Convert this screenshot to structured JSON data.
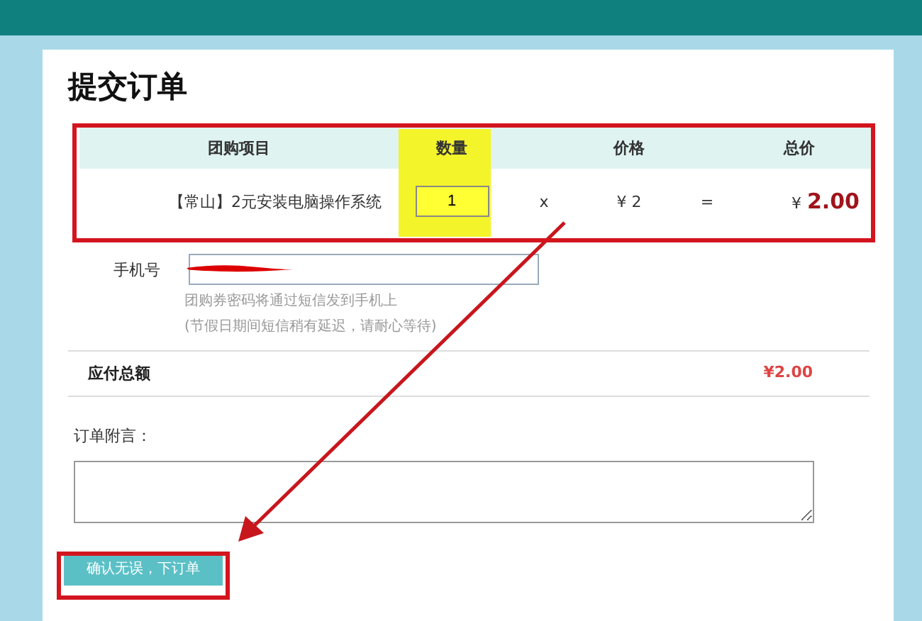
{
  "page": {
    "title": "提交订单"
  },
  "order_table": {
    "columns": [
      "团购项目",
      "数量",
      "",
      "价格",
      "",
      "总价"
    ],
    "row": {
      "item": "【常山】2元安装电脑操作系统",
      "quantity": "1",
      "times": "x",
      "price": "¥ 2",
      "equals": "=",
      "total_currency": "¥",
      "total": "2.00"
    }
  },
  "phone": {
    "label": "手机号",
    "redacted": true,
    "hints": [
      "团购券密码将通过短信发到手机上",
      "(节假日期间短信稍有延迟，请耐心等待)"
    ]
  },
  "summary": {
    "label": "应付总额",
    "amount": "¥2.00"
  },
  "note": {
    "label": "订单附言："
  },
  "submit_button": {
    "label": "确认无误，下订单"
  }
}
